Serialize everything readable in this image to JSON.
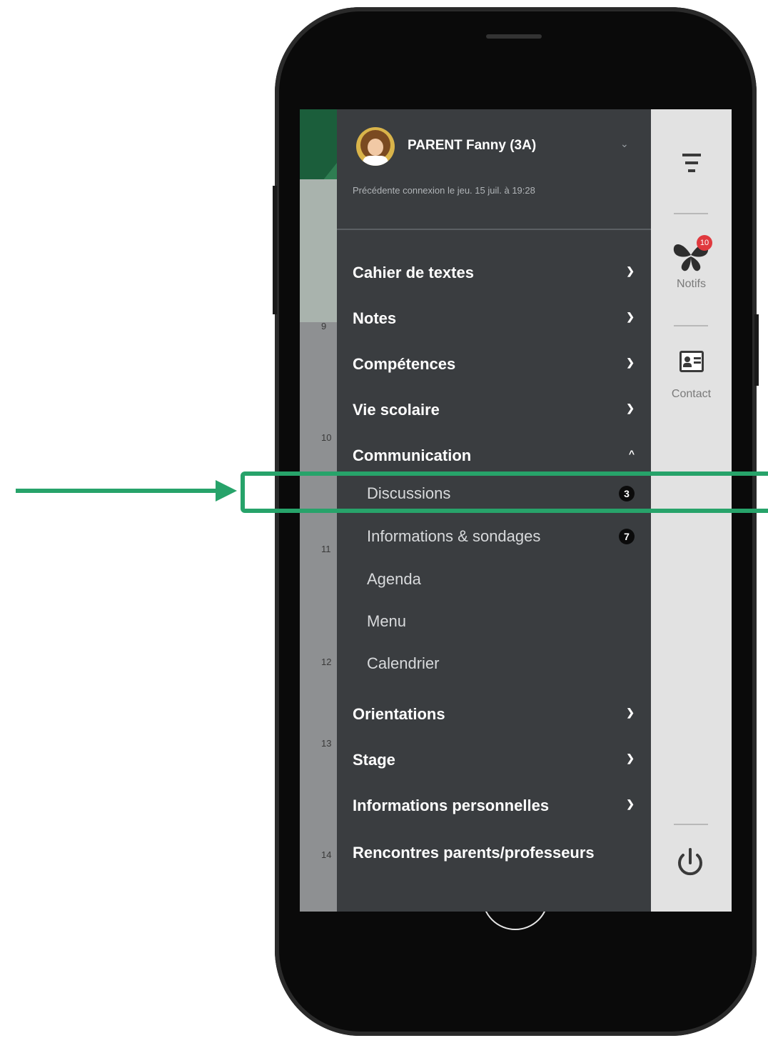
{
  "user": {
    "name": "PARENT Fanny (3A)",
    "last_connection": "Précédente connexion le jeu. 15 juil. à 19:28"
  },
  "menu": {
    "items": [
      {
        "label": "Cahier de textes",
        "state": "collapsed"
      },
      {
        "label": "Notes",
        "state": "collapsed"
      },
      {
        "label": "Compétences",
        "state": "collapsed"
      },
      {
        "label": "Vie scolaire",
        "state": "collapsed"
      },
      {
        "label": "Communication",
        "state": "expanded"
      },
      {
        "label": "Orientations",
        "state": "collapsed"
      },
      {
        "label": "Stage",
        "state": "collapsed"
      },
      {
        "label": "Informations personnelles",
        "state": "collapsed"
      },
      {
        "label": "Rencontres parents/professeurs",
        "state": "none"
      }
    ],
    "communication_sub": [
      {
        "label": "Discussions",
        "badge": "3"
      },
      {
        "label": "Informations & sondages",
        "badge": "7"
      },
      {
        "label": "Agenda"
      },
      {
        "label": "Menu"
      },
      {
        "label": "Calendrier"
      }
    ]
  },
  "rail": {
    "notifs_label": "Notifs",
    "notifs_count": "10",
    "contact_label": "Contact"
  },
  "background_ticks": [
    "9",
    "10",
    "11",
    "12",
    "13",
    "14"
  ],
  "colors": {
    "menu_bg": "#3a3d40",
    "rail_bg": "#e2e2e2",
    "highlight": "#27a36a",
    "notif_badge": "#e0393e"
  },
  "icons": [
    "avatar",
    "hamburger-icon",
    "butterfly-notifs-icon",
    "contact-card-icon",
    "power-icon",
    "chevron-down-icon",
    "chevron-up-icon"
  ]
}
